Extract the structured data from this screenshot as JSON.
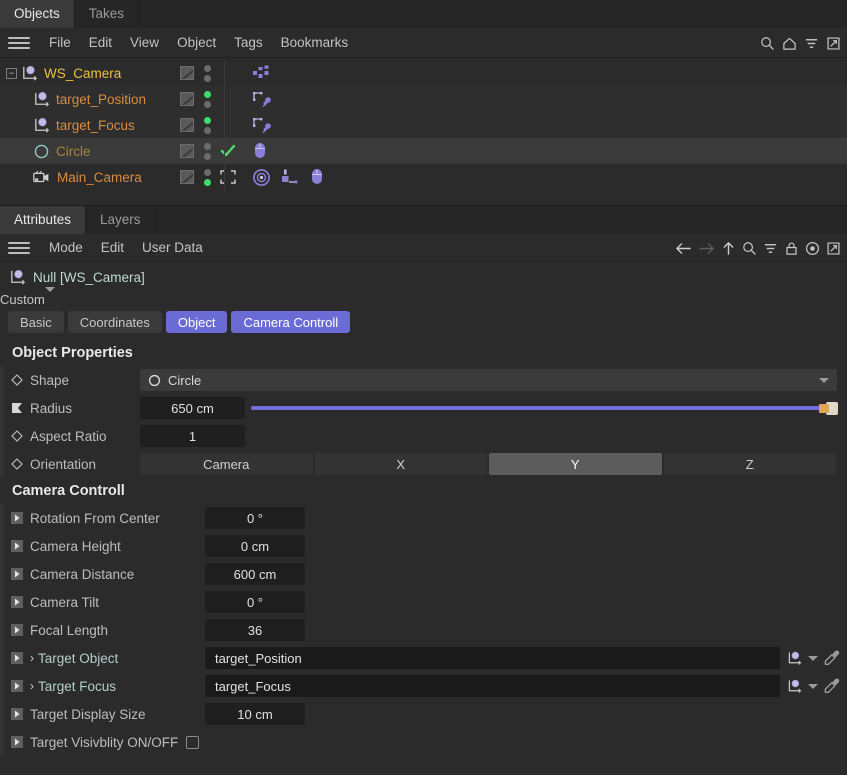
{
  "object_manager": {
    "tabs": [
      {
        "label": "Objects",
        "active": true
      },
      {
        "label": "Takes",
        "active": false
      }
    ],
    "menus": [
      "File",
      "Edit",
      "View",
      "Object",
      "Tags",
      "Bookmarks"
    ],
    "toolbar_icons": [
      "search-icon",
      "home-icon",
      "filter-icon",
      "popout-icon"
    ],
    "tree": [
      {
        "name": "WS_Camera",
        "icon": "null-object-icon",
        "color": "#e8c33a",
        "depth": 0,
        "expander": "-",
        "dots": [
          "gray",
          "gray"
        ],
        "check": false,
        "tags": [
          "mograph-dots-tag"
        ],
        "selected": false
      },
      {
        "name": "target_Position",
        "icon": "null-object-icon",
        "color": "#d98b3f",
        "depth": 1,
        "dots": [
          "green",
          "gray"
        ],
        "check": false,
        "tags": [
          "protection-pin-tag"
        ],
        "selected": false
      },
      {
        "name": "target_Focus",
        "icon": "null-object-icon",
        "color": "#d98b3f",
        "depth": 1,
        "dots": [
          "green",
          "gray"
        ],
        "check": false,
        "tags": [
          "protection-pin-tag"
        ],
        "selected": false
      },
      {
        "name": "Circle",
        "icon": "circle-spline-icon",
        "color": "#a5863f",
        "depth": 1,
        "dots": [
          "gray",
          "gray"
        ],
        "check": true,
        "tags": [
          "xpresso-mouse-tag"
        ],
        "selected": true
      },
      {
        "name": "Main_Camera",
        "icon": "camera-icon",
        "color": "#d98b3f",
        "depth": 1,
        "dots": [
          "gray",
          "green"
        ],
        "check": false,
        "fullscreen_marker": true,
        "tags": [
          "target-tag",
          "constraint-tag",
          "xpresso-mouse-tag"
        ],
        "selected": false
      }
    ]
  },
  "attribute_manager": {
    "tabs": [
      {
        "label": "Attributes",
        "active": true
      },
      {
        "label": "Layers",
        "active": false
      }
    ],
    "menus": [
      "Mode",
      "Edit",
      "User Data"
    ],
    "toolbar_icons": [
      "back-arrow-icon",
      "forward-arrow-icon",
      "up-arrow-icon",
      "search-icon",
      "filter-icon",
      "lock-icon",
      "record-icon",
      "popout-icon"
    ],
    "object_title": "Null [WS_Camera]",
    "object_icon": "null-object-icon",
    "layout_select": "Custom",
    "pills": [
      {
        "label": "Basic",
        "active": false
      },
      {
        "label": "Coordinates",
        "active": false
      },
      {
        "label": "Object",
        "active": true
      },
      {
        "label": "Camera Controll",
        "active": true
      }
    ],
    "object_properties": {
      "title": "Object Properties",
      "shape": {
        "label": "Shape",
        "value": "Circle",
        "icon": "diamond-icon"
      },
      "radius": {
        "label": "Radius",
        "value": "650 cm",
        "icon": "keyframe-flag-icon",
        "slider_percent": 100
      },
      "aspect_ratio": {
        "label": "Aspect Ratio",
        "value": "1",
        "icon": "diamond-icon"
      },
      "orientation": {
        "label": "Orientation",
        "icon": "diamond-icon",
        "options": [
          "Camera",
          "X",
          "Y",
          "Z"
        ],
        "selected": "Y"
      }
    },
    "camera_control": {
      "title": "Camera Controll",
      "params": [
        {
          "label": "Rotation From Center",
          "value": "0 °",
          "type": "number",
          "icon": "userdata-icon"
        },
        {
          "label": "Camera Height",
          "value": "0 cm",
          "type": "number",
          "icon": "userdata-icon"
        },
        {
          "label": "Camera Distance",
          "value": "600 cm",
          "type": "number",
          "icon": "userdata-icon"
        },
        {
          "label": "Camera Tilt",
          "value": "0 °",
          "type": "number",
          "icon": "userdata-icon"
        },
        {
          "label": "Focal Length",
          "value": "36",
          "type": "number",
          "icon": "userdata-icon"
        },
        {
          "label": "Target Object",
          "value": "target_Position",
          "type": "link",
          "icon": "userdata-icon",
          "expandable": true
        },
        {
          "label": "Target Focus",
          "value": "target_Focus",
          "type": "link",
          "icon": "userdata-icon",
          "expandable": true
        },
        {
          "label": "Target Display Size",
          "value": "10 cm",
          "type": "number",
          "icon": "userdata-icon"
        },
        {
          "label": "Target Visivblity ON/OFF",
          "value": "",
          "type": "checkbox",
          "checked": false,
          "icon": "userdata-icon"
        }
      ]
    }
  },
  "colors": {
    "accent": "#6b6bd6",
    "tag_purple": "#9a8ce0",
    "green": "#3ddc6b",
    "slider": "#6f6fd8"
  }
}
